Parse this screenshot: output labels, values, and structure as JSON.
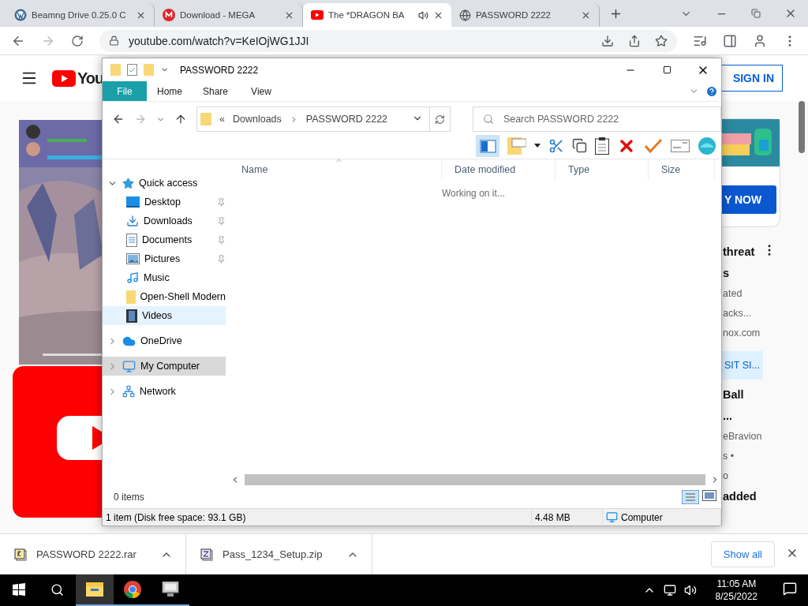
{
  "browser": {
    "tabs": [
      {
        "title": "Beamng Drive 0.25.0 C",
        "kind": "wordpress",
        "selected": false,
        "audio": false
      },
      {
        "title": "Download - MEGA",
        "kind": "mega",
        "selected": false,
        "audio": false
      },
      {
        "title": "The *DRAGON BA",
        "kind": "youtube",
        "selected": true,
        "audio": true
      },
      {
        "title": "PASSWORD 2222",
        "kind": "globe",
        "selected": false,
        "audio": false
      }
    ],
    "url": "youtube.com/watch?v=KeIOjWG1JJI"
  },
  "youtube": {
    "logo_text": "You",
    "sign_in": "SIGN IN",
    "ad_button": "Y NOW",
    "sidebar": [
      {
        "text": "threat",
        "kind": "title"
      },
      {
        "text": "s",
        "kind": "title"
      },
      {
        "text": "ated",
        "kind": "meta"
      },
      {
        "text": "acks...",
        "kind": "meta"
      },
      {
        "text": "nox.com",
        "kind": "meta"
      },
      {
        "text": "SIT SI...",
        "kind": "link"
      },
      {
        "text": "Ball",
        "kind": "title"
      },
      {
        "text": "...",
        "kind": "title"
      },
      {
        "text": "eBravion",
        "kind": "meta"
      },
      {
        "text": "s •",
        "kind": "meta"
      },
      {
        "text": "o",
        "kind": "meta"
      },
      {
        "text": "added",
        "kind": "title"
      }
    ]
  },
  "explorer": {
    "title": "PASSWORD 2222",
    "ribbon_tabs": [
      {
        "label": "File",
        "kind": "file",
        "selected": false
      },
      {
        "label": "Home",
        "kind": "tab",
        "selected": false
      },
      {
        "label": "Share",
        "kind": "tab",
        "selected": false
      },
      {
        "label": "View",
        "kind": "tab",
        "selected": false
      }
    ],
    "path_prefix": "«",
    "path": [
      "Downloads",
      "PASSWORD 2222"
    ],
    "search": {
      "placeholder": "Search PASSWORD 2222"
    },
    "columns": [
      "Name",
      "Date modified",
      "Type",
      "Size"
    ],
    "message": "Working on it...",
    "tree": [
      {
        "label": "Quick access",
        "kind": "star",
        "expanded": true,
        "selected": false,
        "highlighted": false,
        "children": [
          {
            "label": "Desktop",
            "kind": "desktop",
            "pinned": true,
            "selected": false,
            "highlighted": false
          },
          {
            "label": "Downloads",
            "kind": "downloads",
            "pinned": true,
            "selected": false,
            "highlighted": false
          },
          {
            "label": "Documents",
            "kind": "documents",
            "pinned": true,
            "selected": false,
            "highlighted": false
          },
          {
            "label": "Pictures",
            "kind": "pictures",
            "pinned": true,
            "selected": false,
            "highlighted": false
          },
          {
            "label": "Music",
            "kind": "music",
            "pinned": false,
            "selected": false,
            "highlighted": false
          },
          {
            "label": "Open-Shell Modern",
            "kind": "folder",
            "pinned": false,
            "selected": false,
            "highlighted": false
          },
          {
            "label": "Videos",
            "kind": "videos",
            "pinned": false,
            "selected": false,
            "highlighted": true
          }
        ]
      },
      {
        "label": "OneDrive",
        "kind": "cloud",
        "expanded": false,
        "selected": false,
        "highlighted": false
      },
      {
        "label": "My Computer",
        "kind": "computer",
        "expanded": false,
        "selected": true,
        "highlighted": false
      },
      {
        "label": "Network",
        "kind": "network",
        "expanded": false,
        "selected": false,
        "highlighted": false
      }
    ],
    "item_count": "0 items",
    "status": [
      "1 item (Disk free space: 93.1 GB)",
      "4.48 MB",
      "Computer"
    ]
  },
  "downloads": {
    "items": [
      {
        "name": "PASSWORD 2222.rar",
        "kind": "rar"
      },
      {
        "name": "Pass_1234_Setup.zip",
        "kind": "zip"
      }
    ],
    "show_all": "Show all"
  },
  "taskbar": {
    "apps": [
      {
        "kind": "explorer",
        "selected": true
      },
      {
        "kind": "chrome",
        "selected": false
      },
      {
        "kind": "monitor",
        "selected": false
      }
    ],
    "time": "11:05 AM",
    "date": "8/25/2022"
  }
}
